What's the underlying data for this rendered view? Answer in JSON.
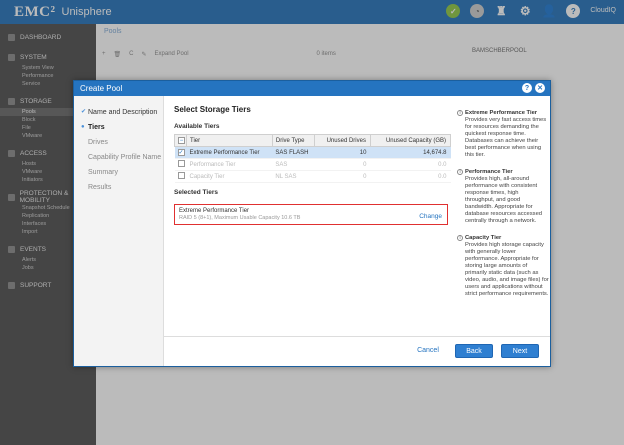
{
  "app": {
    "brand": "EMC²",
    "product": "Unisphere",
    "top_logo": "CloudIQ"
  },
  "sidebar": {
    "sections": [
      {
        "label": "DASHBOARD",
        "items": []
      },
      {
        "label": "SYSTEM",
        "items": [
          "System View",
          "Performance",
          "Service"
        ]
      },
      {
        "label": "STORAGE",
        "items": [
          "Pools",
          "Block",
          "File",
          "VMware"
        ]
      },
      {
        "label": "ACCESS",
        "items": [
          "Hosts",
          "VMware",
          "Initiators"
        ]
      },
      {
        "label": "PROTECTION & MOBILITY",
        "items": [
          "Snapshot Schedule",
          "Replication",
          "Interfaces",
          "Import"
        ]
      },
      {
        "label": "EVENTS",
        "items": [
          "Alerts",
          "Jobs"
        ]
      },
      {
        "label": "SUPPORT",
        "items": []
      }
    ]
  },
  "background": {
    "tab": "Pools",
    "toolbar": [
      "+",
      "🗑",
      "C",
      "✎",
      "Expand Pool"
    ],
    "items_count": "0 items",
    "right_title": "BAMSCHBERPOOL"
  },
  "dialog": {
    "title": "Create Pool",
    "steps": [
      {
        "label": "Name and Description",
        "state": "done"
      },
      {
        "label": "Tiers",
        "state": "current"
      },
      {
        "label": "Drives",
        "state": "pending"
      },
      {
        "label": "Capability Profile Name",
        "state": "pending"
      },
      {
        "label": "Summary",
        "state": "pending"
      },
      {
        "label": "Results",
        "state": "pending"
      }
    ],
    "heading": "Select Storage Tiers",
    "available_label": "Available Tiers",
    "table": {
      "columns": [
        "Tier",
        "Drive Type",
        "Unused Drives",
        "Unused Capacity (GB)"
      ],
      "rows": [
        {
          "tier": "Extreme Performance Tier",
          "drive_type": "SAS FLASH",
          "unused_drives": "10",
          "unused_capacity": "14,674.8",
          "checked": true,
          "disabled": false
        },
        {
          "tier": "Performance Tier",
          "drive_type": "SAS",
          "unused_drives": "0",
          "unused_capacity": "0.0",
          "checked": false,
          "disabled": true
        },
        {
          "tier": "Capacity Tier",
          "drive_type": "NL SAS",
          "unused_drives": "0",
          "unused_capacity": "0.0",
          "checked": false,
          "disabled": true
        }
      ]
    },
    "selected_label": "Selected Tiers",
    "selected": {
      "title": "Extreme Performance Tier",
      "detail": "RAID 5 (8+1), Maximum Usable Capacity 10.6 TB",
      "change": "Change"
    },
    "info": [
      {
        "title": "Extreme Performance Tier",
        "text": "Provides very fast access times for resources demanding the quickest response time. Databases can achieve their best performance when using this tier."
      },
      {
        "title": "Performance Tier",
        "text": "Provides high, all-around performance with consistent response times, high throughput, and good bandwidth. Appropriate for database resources accessed centrally through a network."
      },
      {
        "title": "Capacity Tier",
        "text": "Provides high storage capacity with generally lower performance. Appropriate for storing large amounts of primarily static data (such as video, audio, and image files) for users and applications without strict performance requirements."
      }
    ],
    "buttons": {
      "cancel": "Cancel",
      "back": "Back",
      "next": "Next"
    }
  }
}
